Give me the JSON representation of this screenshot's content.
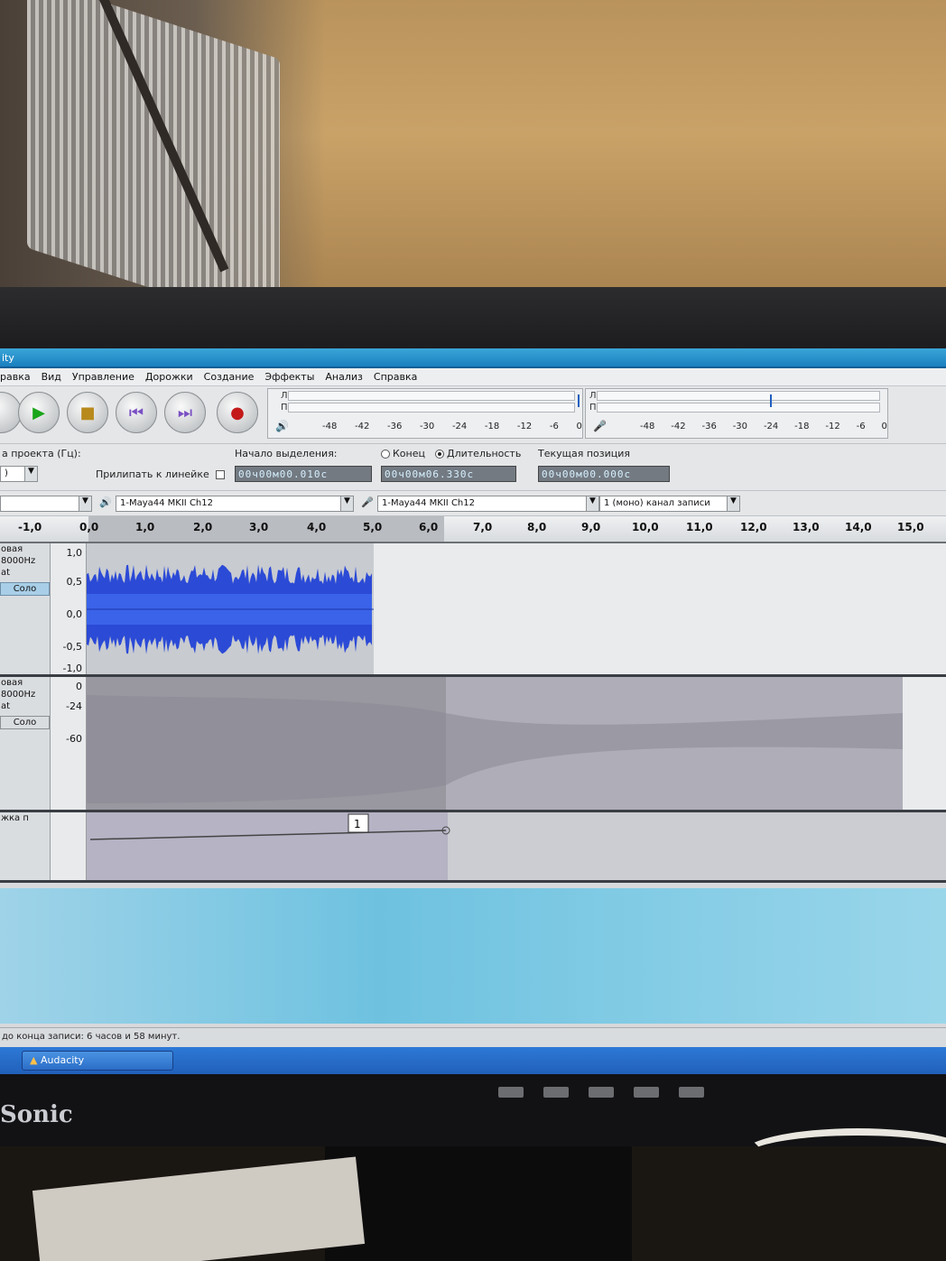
{
  "app": {
    "title": "ity",
    "taskbar_label": "Audacity"
  },
  "menu": [
    "равка",
    "Вид",
    "Управление",
    "Дорожки",
    "Создание",
    "Эффекты",
    "Анализ",
    "Справка"
  ],
  "meters": {
    "play": {
      "l": "Л",
      "r": "П",
      "ticks": [
        "-48",
        "-42",
        "-36",
        "-30",
        "-24",
        "-18",
        "-12",
        "-6",
        "0"
      ]
    },
    "record": {
      "l": "Л",
      "r": "П",
      "ticks": [
        "-48",
        "-42",
        "-36",
        "-30",
        "-24",
        "-18",
        "-12",
        "-6",
        "0"
      ]
    }
  },
  "selection": {
    "rate_label": "а проекта (Гц):",
    "rate_value": ")",
    "snap_label": "Прилипать к линейке",
    "start_label": "Начало выделения:",
    "end_label": "Конец",
    "length_label": "Длительность",
    "position_label": "Текущая позиция",
    "start_value": "00ч00м00.010с",
    "length_value": "00ч00м06.330с",
    "position_value": "00ч00м00.000с"
  },
  "devices": {
    "playback": "1-Maya44 MKII Ch12",
    "recording": "1-Maya44 MKII Ch12",
    "channels": "1 (моно) канал записи"
  },
  "ruler": [
    "-1,0",
    "0,0",
    "1,0",
    "2,0",
    "3,0",
    "4,0",
    "5,0",
    "6,0",
    "7,0",
    "8,0",
    "9,0",
    "10,0",
    "11,0",
    "12,0",
    "13,0",
    "14,0",
    "15,0"
  ],
  "tracks": [
    {
      "name": "овая",
      "rate": "8000Hz",
      "format": "at",
      "solo": "Соло",
      "scale": [
        "1,0",
        "0,5",
        "0,0",
        "-0,5",
        "-1,0"
      ]
    },
    {
      "name": "овая",
      "rate": "8000Hz",
      "format": "at",
      "solo": "Соло",
      "scale": [
        "0",
        "-24",
        "-60"
      ]
    },
    {
      "name": "жка п"
    }
  ],
  "label_track_value": "1",
  "status_text": "до конца записи: 6 часов и 58 минут.",
  "monitor_brand": "Sonic",
  "colors": {
    "waveform": "#2b4ad6",
    "spectro": "#9a98a6",
    "titlebar": "#1b7fbf"
  }
}
